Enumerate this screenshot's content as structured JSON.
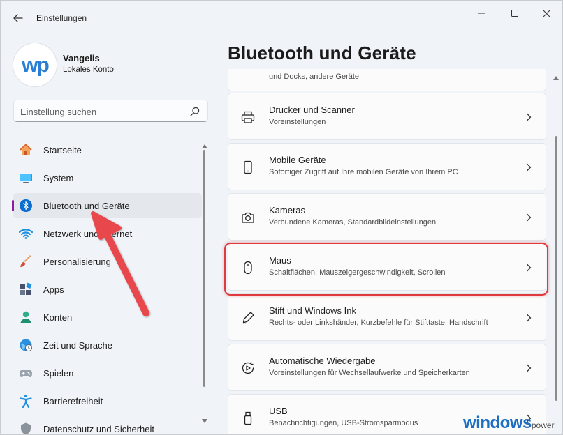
{
  "window": {
    "title": "Einstellungen",
    "back_icon": "back-arrow-icon",
    "controls": [
      "minimize-icon",
      "maximize-icon",
      "close-icon"
    ]
  },
  "profile": {
    "avatar_text": "wp",
    "name": "Vangelis",
    "account_type": "Lokales Konto"
  },
  "search": {
    "placeholder": "Einstellung suchen",
    "icon": "search-icon"
  },
  "sidebar": {
    "items": [
      {
        "label": "Startseite",
        "icon": "home-icon",
        "active": false
      },
      {
        "label": "System",
        "icon": "monitor-icon",
        "active": false
      },
      {
        "label": "Bluetooth und Geräte",
        "icon": "bluetooth-icon",
        "active": true
      },
      {
        "label": "Netzwerk und Internet",
        "icon": "wifi-icon",
        "active": false
      },
      {
        "label": "Personalisierung",
        "icon": "brush-icon",
        "active": false
      },
      {
        "label": "Apps",
        "icon": "apps-icon",
        "active": false
      },
      {
        "label": "Konten",
        "icon": "person-icon",
        "active": false
      },
      {
        "label": "Zeit und Sprache",
        "icon": "globe-clock-icon",
        "active": false
      },
      {
        "label": "Spielen",
        "icon": "gamepad-icon",
        "active": false
      },
      {
        "label": "Barrierefreiheit",
        "icon": "accessibility-icon",
        "active": false
      },
      {
        "label": "Datenschutz und Sicherheit",
        "icon": "shield-icon",
        "active": false
      }
    ],
    "accent_color": "#8a1c9e"
  },
  "page": {
    "title": "Bluetooth und Geräte",
    "partial_card_subtitle": "und Docks, andere Geräte",
    "cards": [
      {
        "title": "Drucker und Scanner",
        "subtitle": "Voreinstellungen",
        "icon": "printer-icon"
      },
      {
        "title": "Mobile Geräte",
        "subtitle": "Sofortiger Zugriff auf Ihre mobilen Geräte von Ihrem PC",
        "icon": "phone-icon"
      },
      {
        "title": "Kameras",
        "subtitle": "Verbundene Kameras, Standardbildeinstellungen",
        "icon": "camera-icon"
      },
      {
        "title": "Maus",
        "subtitle": "Schaltflächen, Mauszeigergeschwindigkeit, Scrollen",
        "icon": "mouse-icon",
        "highlighted": true
      },
      {
        "title": "Stift und Windows Ink",
        "subtitle": "Rechts- oder Linkshänder, Kurzbefehle für Stifttaste, Handschrift",
        "icon": "pen-icon"
      },
      {
        "title": "Automatische Wiedergabe",
        "subtitle": "Voreinstellungen für Wechsellaufwerke und Speicherkarten",
        "icon": "autoplay-icon"
      },
      {
        "title": "USB",
        "subtitle": "Benachrichtigungen, USB-Stromsparmodus",
        "icon": "usb-icon"
      }
    ],
    "highlight_color": "#e0393e"
  },
  "watermark": {
    "main": "windows",
    "sub": "power"
  }
}
